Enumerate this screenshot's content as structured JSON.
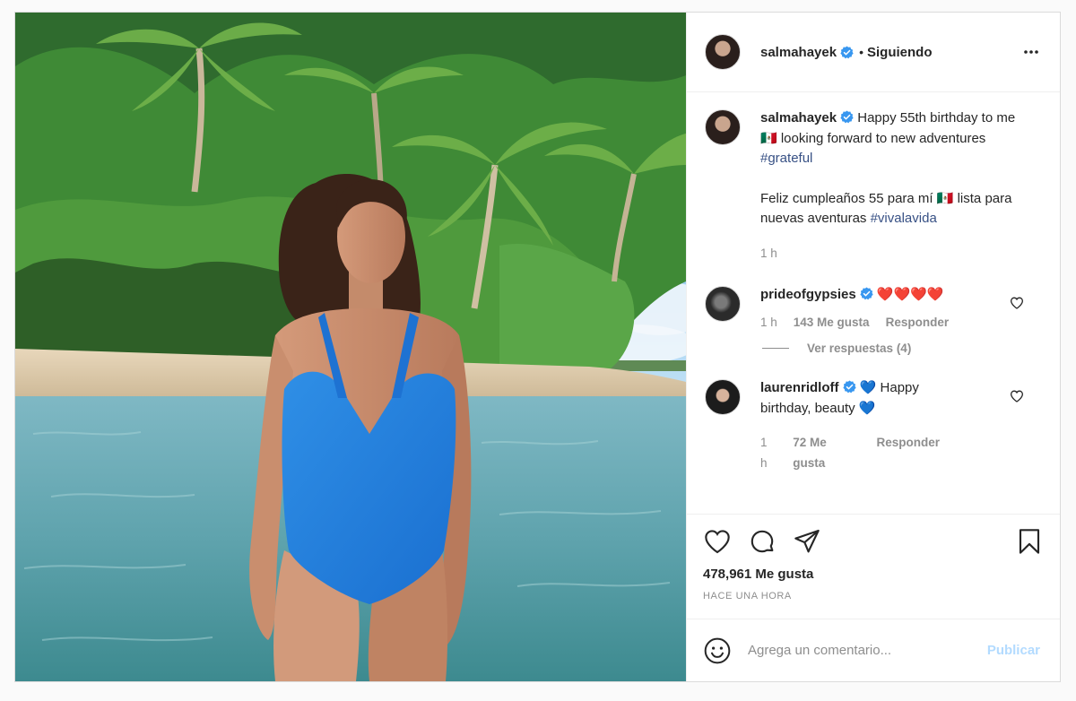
{
  "post": {
    "author": "salmahayek",
    "follow_label": "Siguiendo",
    "separator": "•",
    "more_label": "•••"
  },
  "caption": {
    "username": "salmahayek",
    "line1": "Happy 55th birthday to me 🇲🇽 looking forward to new adventures ",
    "hashtag1": "#grateful",
    "line2": "Feliz cumpleaños 55 para mí 🇲🇽 lista para nuevas aventuras ",
    "hashtag2": "#vivalavida",
    "time": "1 h"
  },
  "comments": [
    {
      "username": "prideofgypsies",
      "text": "❤️❤️❤️❤️",
      "time": "1 h",
      "likes": "143 Me gusta",
      "reply": "Responder",
      "view_replies": "Ver respuestas (4)"
    },
    {
      "username": "laurenridloff",
      "text_icon": "💙",
      "text": " Happy birthday, beauty ",
      "text_end": "💙",
      "time": "1 h",
      "likes": "72 Me gusta",
      "reply": "Responder"
    }
  ],
  "actions": {
    "likes": "478,961 Me gusta",
    "posted": "HACE UNA HORA"
  },
  "composer": {
    "placeholder": "Agrega un comentario...",
    "publish": "Publicar"
  },
  "colors": {
    "verified": "#3897f0",
    "link": "#385185",
    "publish_disabled": "#b3dbff",
    "heart_red": "#ed4956",
    "heart_teal": "#13b8c4"
  }
}
